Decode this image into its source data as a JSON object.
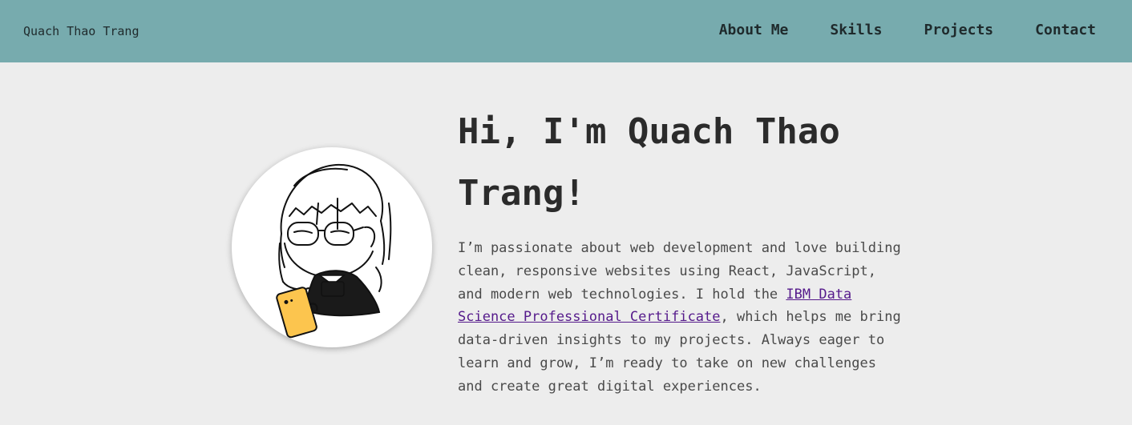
{
  "navbar": {
    "brand": "Quach Thao Trang",
    "links": [
      {
        "label": "About Me"
      },
      {
        "label": "Skills"
      },
      {
        "label": "Projects"
      },
      {
        "label": "Contact"
      }
    ],
    "background_color": "#77abae"
  },
  "hero": {
    "title": "Hi, I'm Quach Thao Trang!",
    "intro_before_link": "I’m passionate about web development and love building clean, responsive websites using React, JavaScript, and modern web technologies. I hold the ",
    "certificate_link": "IBM Data Science Professional Certificate",
    "intro_after_link": ", which helps me bring data-driven insights to my projects. Always eager to learn and grow, I’m ready to take on new challenges and create great digital experiences."
  },
  "colors": {
    "page_background": "#ededed",
    "link_visited": "#551a8b",
    "phone": "#fcc54e"
  },
  "icons": {
    "avatar": "girl-with-glasses-holding-phone-illustration"
  }
}
